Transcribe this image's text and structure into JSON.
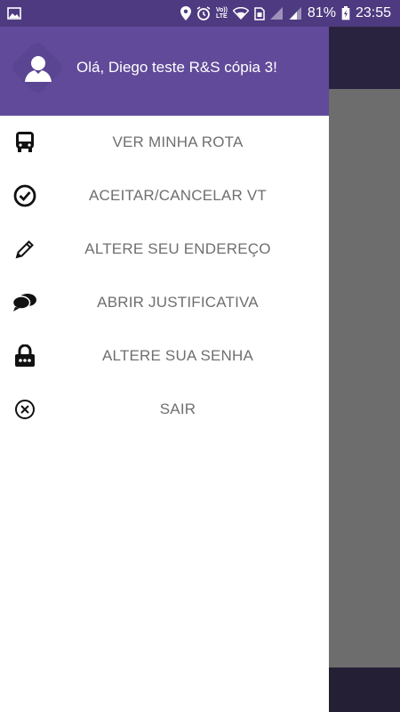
{
  "status_bar": {
    "battery_percent": "81%",
    "time": "23:55",
    "network_label_top": "Vo))",
    "network_label_bottom": "LTE",
    "icons": [
      "image-icon",
      "location-icon",
      "alarm-icon",
      "volte-icon",
      "wifi-icon",
      "sim-icon",
      "signal-icon",
      "signal-icon",
      "battery-charging-icon"
    ]
  },
  "drawer": {
    "greeting": "Olá, Diego teste R&S cópia 3!",
    "items": [
      {
        "label": "VER MINHA ROTA",
        "icon": "bus-icon"
      },
      {
        "label": "ACEITAR/CANCELAR VT",
        "icon": "check-circle-icon"
      },
      {
        "label": "ALTERE SEU ENDEREÇO",
        "icon": "pencil-icon"
      },
      {
        "label": "ABRIR JUSTIFICATIVA",
        "icon": "chat-bubbles-icon"
      },
      {
        "label": "ALTERE SUA SENHA",
        "icon": "lock-icon"
      },
      {
        "label": "SAIR",
        "icon": "close-circle-icon"
      }
    ]
  },
  "colors": {
    "status_bar": "#4e3a80",
    "drawer_header": "#614a99",
    "menu_text": "#6f6f6f",
    "scrim": "#6b6b6b"
  }
}
